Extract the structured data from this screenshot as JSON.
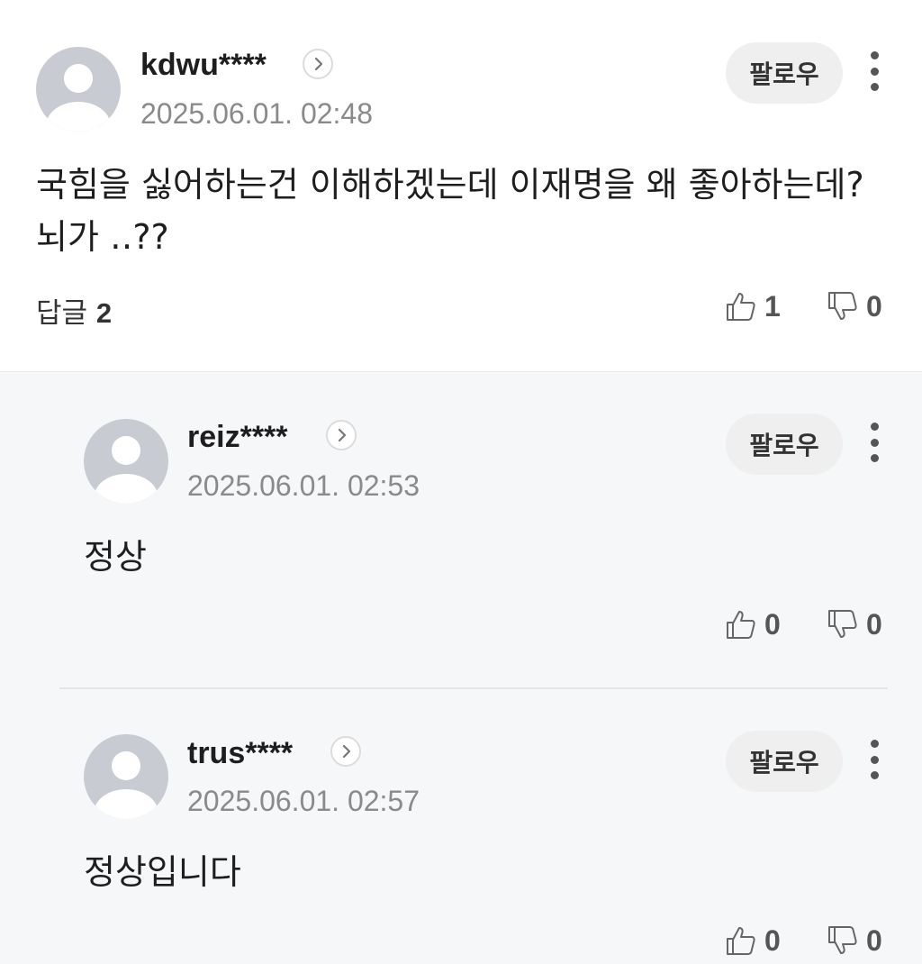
{
  "comment": {
    "username": "kdwu****",
    "timestamp": "2025.06.01. 02:48",
    "follow_label": "팔로우",
    "text": "국힘을 싫어하는건 이해하겠는데 이재명을 왜 좋아하는데? 뇌가  ‥??",
    "reply_label": "답글",
    "reply_count": "2",
    "likes": "1",
    "dislikes": "0"
  },
  "replies": [
    {
      "username": "reiz****",
      "timestamp": "2025.06.01. 02:53",
      "follow_label": "팔로우",
      "text": "정상",
      "likes": "0",
      "dislikes": "0"
    },
    {
      "username": "trus****",
      "timestamp": "2025.06.01. 02:57",
      "follow_label": "팔로우",
      "text": "정상입니다",
      "likes": "0",
      "dislikes": "0"
    }
  ],
  "icons": {
    "profile_arrow": "chevron-right-icon",
    "more": "more-vertical-icon",
    "like": "thumbs-up-icon",
    "dislike": "thumbs-down-icon"
  }
}
